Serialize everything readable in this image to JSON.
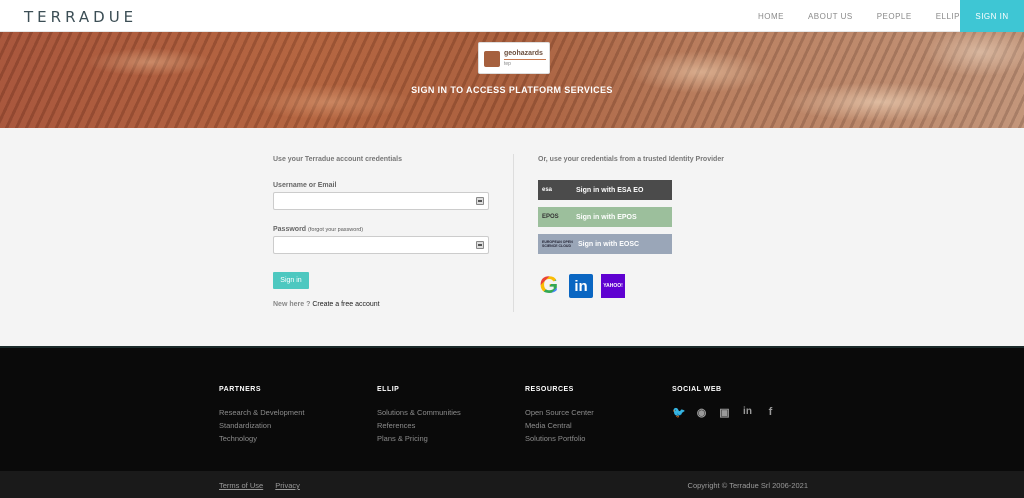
{
  "header": {
    "logo_text": "TERRADUE",
    "nav": [
      "HOME",
      "ABOUT US",
      "PEOPLE",
      "ELLIP"
    ],
    "signin_label": "SIGN IN"
  },
  "hero": {
    "logo_title": "geohazards",
    "logo_sub": "tep",
    "title": "SIGN IN TO ACCESS PLATFORM SERVICES"
  },
  "login": {
    "heading": "Use your Terradue account credentials",
    "username_label": "Username or Email",
    "password_label": "Password",
    "forgot_label": "(forgot your password)",
    "submit_label": "Sign in",
    "newhere": "New here ?",
    "create_account": "Create a free account"
  },
  "idp": {
    "heading": "Or, use your credentials from a trusted Identity Provider",
    "providers": [
      {
        "mark": "esa",
        "label": "Sign in with ESA EO",
        "color": "#4b4b4b"
      },
      {
        "mark": "EPOS",
        "label": "Sign in with EPOS",
        "color": "#9cbf9c"
      },
      {
        "mark": "EUROPEAN OPEN SCIENCE CLOUD",
        "label": "Sign in with EOSC",
        "color": "#9aa6b8"
      }
    ],
    "social": [
      {
        "icon": "google-icon",
        "glyph": "G",
        "color": "#ffffff"
      },
      {
        "icon": "linkedin-icon",
        "glyph": "in",
        "color": "#0a66c2"
      },
      {
        "icon": "yahoo-icon",
        "glyph": "YAHOO!",
        "color": "#5f01d1"
      }
    ]
  },
  "footer": {
    "partners": {
      "title": "PARTNERS",
      "items": [
        "Research & Development",
        "Standardization",
        "Technology"
      ]
    },
    "ellip": {
      "title": "ELLIP",
      "items": [
        "Solutions & Communities",
        "References",
        "Plans & Pricing"
      ]
    },
    "resources": {
      "title": "RESOURCES",
      "items": [
        "Open Source Center",
        "Media Central",
        "Solutions Portfolio"
      ]
    },
    "social": {
      "title": "SOCIAL WEB",
      "icons": [
        "twitter-icon",
        "github-icon",
        "slideshare-icon",
        "linkedin-icon",
        "facebook-icon"
      ]
    },
    "terms": "Terms of Use",
    "privacy": "Privacy",
    "copyright": "Copyright © Terradue Srl 2006-2021"
  }
}
